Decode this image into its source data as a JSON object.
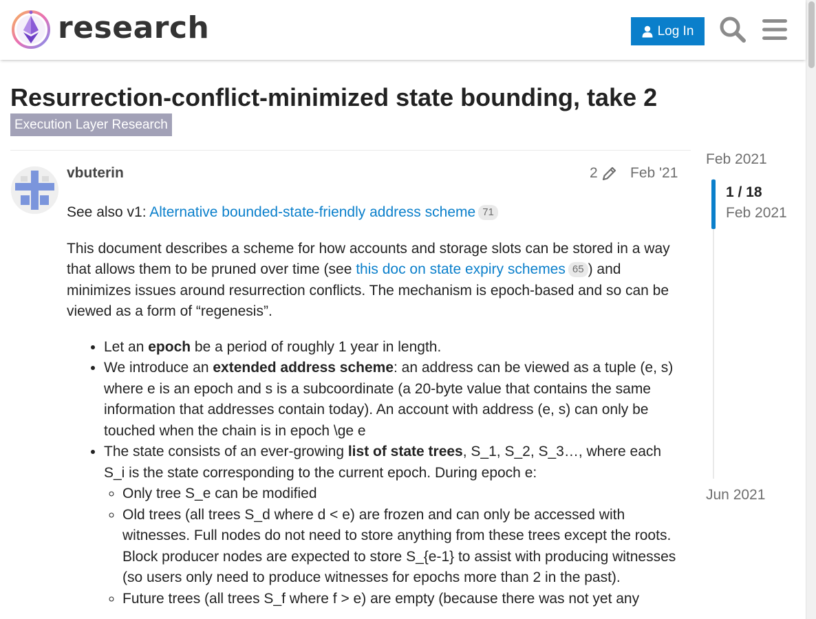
{
  "header": {
    "logo_text": "research",
    "login_label": "Log In",
    "icons": [
      "search-icon",
      "hamburger-menu-icon"
    ]
  },
  "topic": {
    "title": "Resurrection-conflict-minimized state bounding, take 2",
    "category": "Execution Layer Research"
  },
  "post": {
    "username": "vbuterin",
    "edit_count": "2",
    "date": "Feb '21",
    "intro_prefix": "See also v1: ",
    "intro_link": "Alternative bounded-state-friendly address scheme",
    "intro_link_clicks": "71",
    "p1_part1": "This document describes a scheme for how accounts and storage slots can be stored in a way that allows them to be pruned over time (see ",
    "p1_link": "this doc on state expiry schemes",
    "p1_link_clicks": "65",
    "p1_part2": ") and minimizes issues around resurrection conflicts. The mechanism is epoch-based and so can be viewed as a form of “regenesis”.",
    "b1_pre": "Let an ",
    "b1_bold": "epoch",
    "b1_post": " be a period of roughly 1 year in length.",
    "b2_pre": "We introduce an ",
    "b2_bold": "extended address scheme",
    "b2_post": ": an address can be viewed as a tuple (e, s) where e is an epoch and s is a subcoordinate (a 20-byte value that contains the same information that addresses contain today). An account with address (e, s) can only be touched when the chain is in epoch \\ge e",
    "b3_pre": "The state consists of an ever-growing ",
    "b3_bold": "list of state trees",
    "b3_post": ", S_1, S_2, S_3…, where each S_i is the state corresponding to the current epoch. During epoch e:",
    "sub1": "Only tree S_e can be modified",
    "sub2": "Old trees (all trees S_d where d < e) are frozen and can only be accessed with witnesses. Full nodes do not need to store anything from these trees except the roots. Block producer nodes are expected to store S_{e-1} to assist with producing witnesses (so users only need to produce witnesses for epochs more than 2 in the past).",
    "sub3": "Future trees (all trees S_f where f > e) are empty (because there was not yet any"
  },
  "timeline": {
    "start_date": "Feb 2021",
    "position": "1 / 18",
    "current_date": "Feb 2021",
    "end_date": "Jun 2021"
  },
  "colors": {
    "accent": "#0a7fcb",
    "category_badge": "#a2a1b7"
  }
}
